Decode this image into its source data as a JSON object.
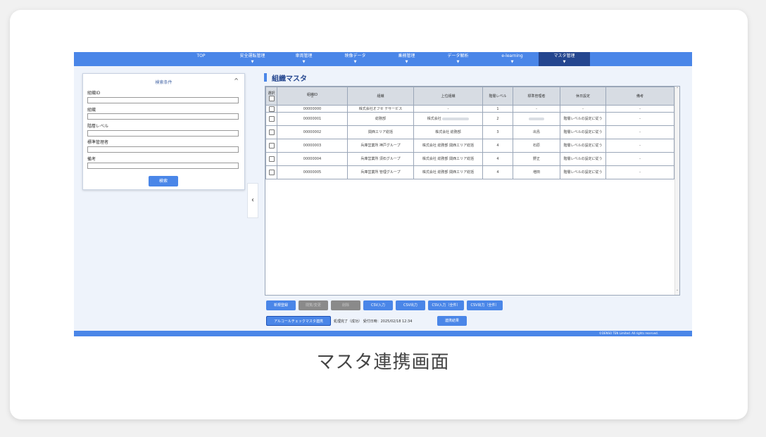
{
  "nav": {
    "items": [
      {
        "label": "TOP",
        "has_dropdown": false
      },
      {
        "label": "安全運転管理",
        "has_dropdown": true
      },
      {
        "label": "車両管理",
        "has_dropdown": true
      },
      {
        "label": "映像データ",
        "has_dropdown": true
      },
      {
        "label": "乗務管理",
        "has_dropdown": true
      },
      {
        "label": "データ解析",
        "has_dropdown": true
      },
      {
        "label": "e-learning",
        "has_dropdown": true
      },
      {
        "label": "マスタ管理",
        "has_dropdown": true,
        "active": true
      }
    ],
    "dropdown_glyph": "▼"
  },
  "search": {
    "title": "検索条件",
    "toggle_icon": "^",
    "fields": [
      {
        "label": "組織ID",
        "value": ""
      },
      {
        "label": "組織",
        "value": ""
      },
      {
        "label": "階層レベル",
        "value": ""
      },
      {
        "label": "標準管理者",
        "value": ""
      },
      {
        "label": "備考",
        "value": ""
      }
    ],
    "button_label": "検索"
  },
  "collapse_icon": "‹",
  "page_title": "組織マスタ",
  "table": {
    "headers": {
      "select": "選択",
      "org_id": "組織ID",
      "org_id_sort": "^",
      "org": "組織",
      "parent_org": "上位組織",
      "level": "階層レベル",
      "manager": "標準管理者",
      "holiday": "休日設定",
      "note": "備考"
    },
    "rows": [
      {
        "org_id": "00000000",
        "org": "株式会社オフセ テサービス",
        "parent": "-",
        "level": "1",
        "manager": "-",
        "holiday": "-",
        "note": "-",
        "short": true
      },
      {
        "org_id": "00000001",
        "org": "総務部",
        "parent": "株式会社",
        "level": "2",
        "manager": "",
        "holiday": "階層レベルの設定に従う",
        "note": "-"
      },
      {
        "org_id": "00000002",
        "org": "関西エリア総括",
        "parent": "株式会社 総務部",
        "level": "3",
        "manager": "出島",
        "holiday": "階層レベルの設定に従う",
        "note": "-"
      },
      {
        "org_id": "00000003",
        "org": "兵庫営業所 神戸グループ",
        "parent": "株式会社 総務部 関西エリア総括",
        "level": "4",
        "manager": "石原",
        "holiday": "階層レベルの設定に従う",
        "note": "-"
      },
      {
        "org_id": "00000004",
        "org": "兵庫営業所 須石グループ",
        "parent": "株式会社 総務部 関西エリア総括",
        "level": "4",
        "manager": "野正",
        "holiday": "階層レベルの設定に従う",
        "note": "-"
      },
      {
        "org_id": "00000005",
        "org": "兵庫営業所 管理グループ",
        "parent": "株式会社 総務部 関西エリア総括",
        "level": "4",
        "manager": "増田",
        "holiday": "階層レベルの設定に従う",
        "note": "-"
      }
    ],
    "scroll_up": "˄",
    "scroll_down": "˅"
  },
  "actions": {
    "new": "新規登録",
    "edit": "閲覧/変更",
    "delete": "削除",
    "csv_import": "CSV入力",
    "csv_export": "CSV出力",
    "csv_import_all": "CSV入力（全件）",
    "csv_export_all": "CSV出力（全件）",
    "alcohol_sync": "アルコールチェックマスタ連携",
    "sync_result": "連携結果"
  },
  "status_text": "処理完了（成功） 受付日時：2025/02/18 12:34",
  "footer_text": "©DENSO TEN Limited. All rights reserved.",
  "caption": "マスタ連携画面",
  "colors": {
    "nav": "#4a86e8",
    "nav_active": "#24468f",
    "button": "#4a86e8",
    "button_disabled": "#8a8a8a"
  }
}
